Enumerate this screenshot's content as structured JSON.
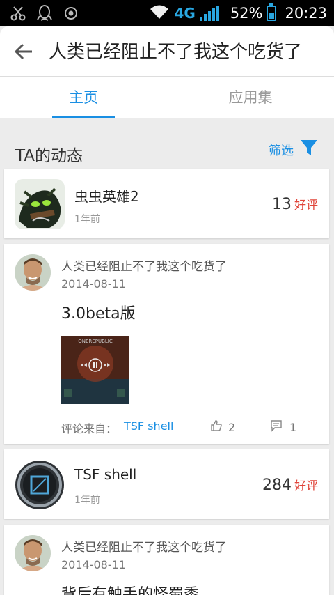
{
  "status_bar": {
    "network": "4G",
    "battery": "52%",
    "battery_level": 0.52,
    "time": "20:23",
    "left_icons": [
      "scissors-icon",
      "qq-penguin-icon",
      "record-icon"
    ]
  },
  "header": {
    "title": "人类已经阻止不了我这个吃货了"
  },
  "tabs": [
    {
      "label": "主页",
      "active": true
    },
    {
      "label": "应用集",
      "active": false
    }
  ],
  "section": {
    "title": "TA的动态",
    "filter_label": "筛选"
  },
  "feed": [
    {
      "type": "app",
      "name": "虫虫英雄2",
      "time": "1年前",
      "score": "13",
      "score_label": "好评"
    },
    {
      "type": "comment",
      "user": "人类已经阻止不了我这个吃货了",
      "date": "2014-08-11",
      "text": "3.0beta版",
      "from_label": "评论来自：",
      "from_app": "TSF shell",
      "likes": "2",
      "comments": "1"
    },
    {
      "type": "app",
      "name": "TSF shell",
      "time": "1年前",
      "score": "284",
      "score_label": "好评"
    },
    {
      "type": "comment",
      "user": "人类已经阻止不了我这个吃货了",
      "date": "2014-08-11",
      "text": "背后有触手的怪蜀黍"
    }
  ],
  "thumbnail_text": "ONEREPUBLIC",
  "colors": {
    "accent": "#1a8fe3",
    "good_review": "#e0453a"
  }
}
